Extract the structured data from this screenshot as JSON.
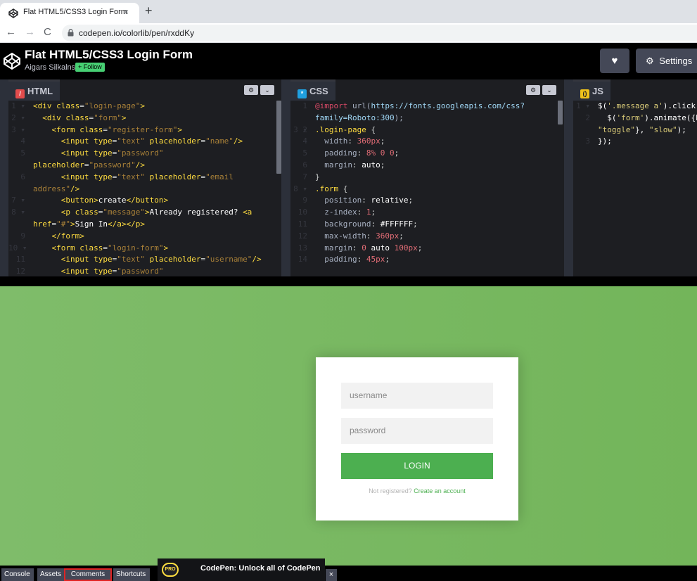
{
  "browser": {
    "tab_title": "Flat HTML5/CSS3 Login Form",
    "tab_close": "×",
    "new_tab": "+",
    "nav_back": "←",
    "nav_forward": "→",
    "nav_reload": "C",
    "url": "codepen.io/colorlib/pen/rxddKy"
  },
  "header": {
    "title": "Flat HTML5/CSS3 Login Form",
    "author": "Aigars Silkalns",
    "follow_label": "+ Follow",
    "heart_label": "♥",
    "settings_label": "Settings"
  },
  "editors": {
    "html": {
      "label": "HTML",
      "icon": "/"
    },
    "css": {
      "label": "CSS",
      "icon": "*"
    },
    "js": {
      "label": "JS",
      "icon": "()"
    },
    "gear": "⚙",
    "chevron": "⌄"
  },
  "preview": {
    "username_placeholder": "username",
    "password_placeholder": "password",
    "login_label": "LOGIN",
    "message": "Not registered?",
    "message_link": "Create an account"
  },
  "bottombar": {
    "console": "Console",
    "assets": "Assets",
    "comments": "Comments",
    "shortcuts": "Shortcuts",
    "pro_badge": "PRO",
    "promo": "CodePen: Unlock all of CodePen",
    "promo_close": "×"
  },
  "colors": {
    "accent": "#47cf73",
    "login_button": "#4caf50",
    "preview_bg": "#76b852",
    "highlight_box": "#e02424"
  }
}
